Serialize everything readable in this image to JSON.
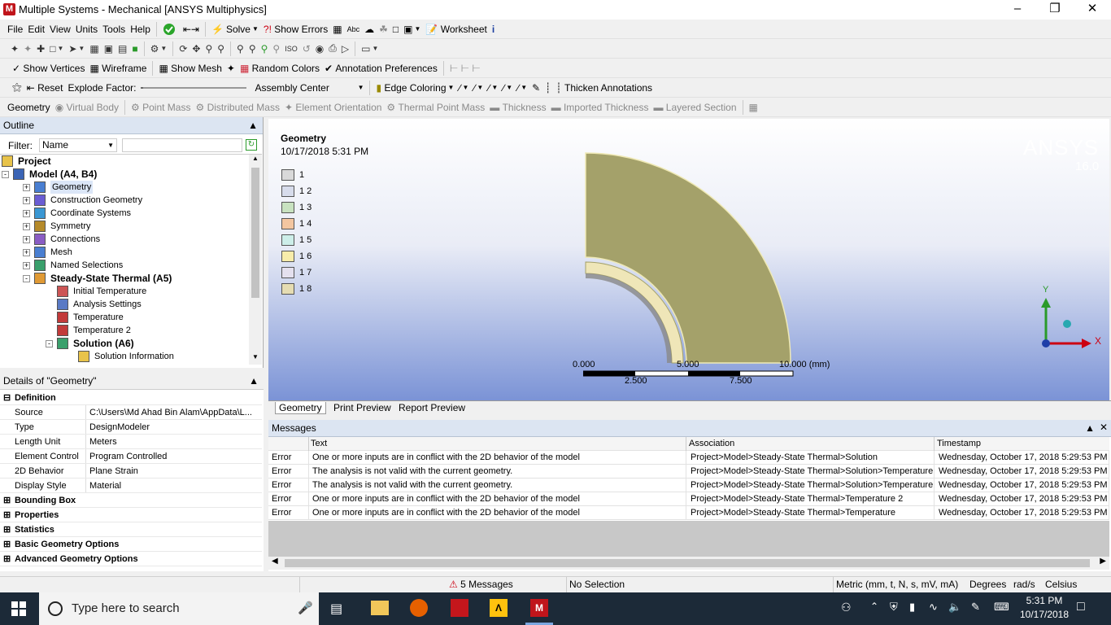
{
  "window": {
    "title": "Multiple Systems - Mechanical [ANSYS Multiphysics]",
    "app_icon": "M"
  },
  "menu": [
    "File",
    "Edit",
    "View",
    "Units",
    "Tools",
    "Help"
  ],
  "toolbar1": {
    "solve": "Solve",
    "show_errors": "Show Errors",
    "worksheet": "Worksheet"
  },
  "toolbar3": {
    "show_vertices": "Show Vertices",
    "wireframe": "Wireframe",
    "show_mesh": "Show Mesh",
    "random_colors": "Random Colors",
    "annotation_prefs": "Annotation Preferences"
  },
  "toolbar4": {
    "reset": "Reset",
    "explode_factor": "Explode Factor:",
    "assembly_center": "Assembly Center",
    "edge_coloring": "Edge Coloring",
    "thicken_annotations": "Thicken Annotations"
  },
  "context_toolbar": [
    "Geometry",
    "Virtual Body",
    "Point Mass",
    "Distributed Mass",
    "Element Orientation",
    "Thermal Point Mass",
    "Thickness",
    "Imported Thickness",
    "Layered Section"
  ],
  "outline": {
    "title": "Outline",
    "filter_label": "Filter:",
    "filter_value": "Name",
    "tree": [
      {
        "label": "Project",
        "bold": true
      },
      {
        "label": "Model (A4, B4)",
        "bold": true
      },
      {
        "label": "Geometry",
        "bold": false
      },
      {
        "label": "Construction Geometry",
        "bold": false
      },
      {
        "label": "Coordinate Systems",
        "bold": false
      },
      {
        "label": "Symmetry",
        "bold": false
      },
      {
        "label": "Connections",
        "bold": false
      },
      {
        "label": "Mesh",
        "bold": false
      },
      {
        "label": "Named Selections",
        "bold": false
      },
      {
        "label": "Steady-State Thermal (A5)",
        "bold": true
      },
      {
        "label": "Initial Temperature",
        "bold": false
      },
      {
        "label": "Analysis Settings",
        "bold": false
      },
      {
        "label": "Temperature",
        "bold": false
      },
      {
        "label": "Temperature 2",
        "bold": false
      },
      {
        "label": "Solution (A6)",
        "bold": true
      },
      {
        "label": "Solution Information",
        "bold": false
      }
    ]
  },
  "details": {
    "title": "Details of \"Geometry\"",
    "sections": [
      "Definition",
      "Bounding Box",
      "Properties",
      "Statistics",
      "Basic Geometry Options",
      "Advanced Geometry Options"
    ],
    "rows": [
      {
        "key": "Source",
        "value": "C:\\Users\\Md Ahad Bin Alam\\AppData\\L..."
      },
      {
        "key": "Type",
        "value": "DesignModeler"
      },
      {
        "key": "Length Unit",
        "value": "Meters"
      },
      {
        "key": "Element Control",
        "value": "Program Controlled"
      },
      {
        "key": "2D Behavior",
        "value": "Plane Strain"
      },
      {
        "key": "Display Style",
        "value": "Material"
      }
    ]
  },
  "viewport": {
    "heading": "Geometry",
    "date": "10/17/2018 5:31 PM",
    "brand": "ANSYS",
    "version": "16.0",
    "legend": [
      {
        "label": "1",
        "color": "#d9d9d9"
      },
      {
        "label": "1 2",
        "color": "#d7dceb"
      },
      {
        "label": "1 3",
        "color": "#c8e2c0"
      },
      {
        "label": "1 4",
        "color": "#f3c6a0"
      },
      {
        "label": "1 5",
        "color": "#cdeee9"
      },
      {
        "label": "1 6",
        "color": "#f7ecaa"
      },
      {
        "label": "1 7",
        "color": "#e4e0ee"
      },
      {
        "label": "1 8",
        "color": "#e5dcb2"
      }
    ],
    "scale_top": [
      "0.000",
      "5.000",
      "10.000 (mm)"
    ],
    "scale_bottom": [
      "2.500",
      "7.500"
    ],
    "axis_y": "Y",
    "axis_x": "X"
  },
  "view_tabs": [
    "Geometry",
    "Print Preview",
    "Report Preview"
  ],
  "messages": {
    "title": "Messages",
    "columns": [
      "Text",
      "Association",
      "Timestamp"
    ],
    "rows": [
      {
        "type": "Error",
        "text": "One or more inputs are in conflict with the 2D behavior of the model",
        "assoc": "Project>Model>Steady-State Thermal>Solution",
        "time": "Wednesday, October 17, 2018 5:29:53 PM"
      },
      {
        "type": "Error",
        "text": "The analysis is not valid with the current geometry.",
        "assoc": "Project>Model>Steady-State Thermal>Solution>Temperature",
        "time": "Wednesday, October 17, 2018 5:29:53 PM"
      },
      {
        "type": "Error",
        "text": "The analysis is not valid with the current geometry.",
        "assoc": "Project>Model>Steady-State Thermal>Solution>Temperature",
        "time": "Wednesday, October 17, 2018 5:29:53 PM"
      },
      {
        "type": "Error",
        "text": "One or more inputs are in conflict with the 2D behavior of the model",
        "assoc": "Project>Model>Steady-State Thermal>Temperature 2",
        "time": "Wednesday, October 17, 2018 5:29:53 PM"
      },
      {
        "type": "Error",
        "text": "One or more inputs are in conflict with the 2D behavior of the model",
        "assoc": "Project>Model>Steady-State Thermal>Temperature",
        "time": "Wednesday, October 17, 2018 5:29:53 PM"
      }
    ]
  },
  "status": {
    "messages": "5 Messages",
    "selection": "No Selection",
    "units": "Metric (mm, t, N, s, mV, mA)",
    "angle": "Degrees",
    "rot": "rad/s",
    "temp": "Celsius"
  },
  "taskbar": {
    "search_placeholder": "Type here to search",
    "time": "5:31 PM",
    "date": "10/17/2018"
  }
}
